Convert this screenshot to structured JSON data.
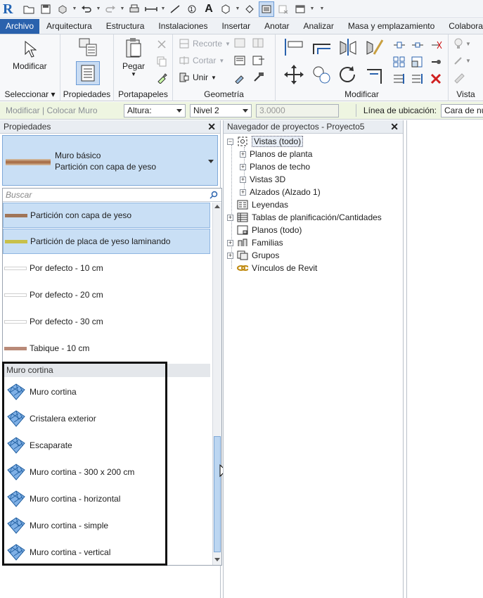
{
  "app": {
    "logo": "R"
  },
  "quick_access": {
    "icons": [
      "open-icon",
      "save-icon",
      "sync-icon",
      "undo-icon",
      "redo-icon",
      "print-icon",
      "measure-icon",
      "dimension-icon",
      "tag-icon",
      "text-icon",
      "3d-view-icon",
      "section-icon",
      "thin-lines-icon",
      "close-views-icon",
      "switch-windows-icon",
      "customize-icon"
    ],
    "text_button": "A"
  },
  "ribbon_tabs": [
    "Archivo",
    "Arquitectura",
    "Estructura",
    "Instalaciones",
    "Insertar",
    "Anotar",
    "Analizar",
    "Masa y emplazamiento",
    "Colaborar"
  ],
  "ribbon": {
    "panels": {
      "select": "Seleccionar",
      "properties": "Propiedades",
      "clipboard": "Portapapeles",
      "geometry": "Geometría",
      "modify": "Modificar",
      "view": "Vista"
    },
    "buttons": {
      "modify": "Modificar",
      "paste": "Pegar",
      "cut_geometry": "Recorte",
      "cut": "Cortar",
      "join": "Unir"
    }
  },
  "options_bar": {
    "context": "Modificar | Colocar Muro",
    "height_label": "Altura:",
    "level": "Nivel 2",
    "height_value": "3.0000",
    "location_line_label": "Línea de ubicación:",
    "location_line_value": "Cara de nu"
  },
  "properties": {
    "title": "Propiedades",
    "type_family": "Muro básico",
    "type_name": "Partición con capa de yeso",
    "search_placeholder": "Buscar",
    "items": [
      {
        "label": "Partición con capa de yeso",
        "swatch": "#a07558",
        "selected": true
      },
      {
        "label": "Partición de placa de yeso laminando",
        "swatch": "#c8c04a",
        "selected": true
      },
      {
        "label": "Por defecto - 10 cm",
        "swatch": "#d9d9d9",
        "selected": false
      },
      {
        "label": "Por defecto - 20 cm",
        "swatch": "#d9d9d9",
        "selected": false
      },
      {
        "label": "Por defecto - 30 cm",
        "swatch": "#d9d9d9",
        "selected": false
      },
      {
        "label": "Tabique - 10 cm",
        "swatch": "#b98a78",
        "selected": false
      }
    ],
    "group_header": "Muro cortina",
    "curtain_items": [
      "Muro cortina",
      "Cristalera exterior",
      "Escaparate",
      "Muro cortina - 300 x 200 cm",
      "Muro cortina - horizontal",
      "Muro cortina - simple",
      "Muro cortina - vertical"
    ]
  },
  "project_browser": {
    "title": "Navegador de proyectos - Proyecto5",
    "root": "Vistas (todo)",
    "view_children": [
      "Planos de planta",
      "Planos de techo",
      "Vistas 3D",
      "Alzados (Alzado 1)"
    ],
    "nodes": [
      "Leyendas",
      "Tablas de planificación/Cantidades",
      "Planos (todo)",
      "Familias",
      "Grupos",
      "Vínculos de Revit"
    ]
  },
  "colors": {
    "file_tab": "#2a62ad",
    "selection": "#c9dff5",
    "options_bar": "#eef5e1"
  }
}
